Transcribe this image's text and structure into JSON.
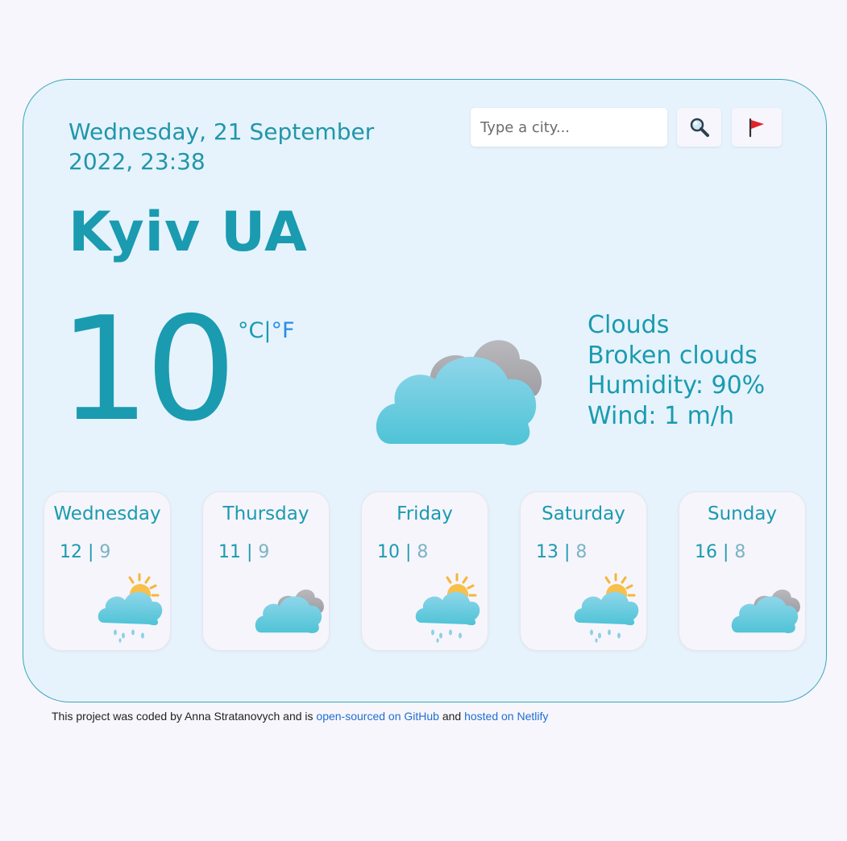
{
  "header": {
    "date_line1": "Wednesday, 21 September",
    "date_line2": "2022, 23:38"
  },
  "search": {
    "placeholder": "Type a city...",
    "search_icon": "magnifying-glass",
    "location_icon": "red-flag"
  },
  "current": {
    "city": "Kyiv UA",
    "temperature": "10",
    "unit_c": "°C",
    "unit_separator": "|",
    "unit_f": "°F",
    "icon": "broken-clouds",
    "description_main": "Clouds",
    "description_detail": "Broken clouds",
    "humidity": "Humidity: 90%",
    "wind": "Wind: 1 m/h"
  },
  "forecast": [
    {
      "day": "Wednesday",
      "max": "12",
      "min": "9",
      "icon": "sun-rain"
    },
    {
      "day": "Thursday",
      "max": "11",
      "min": "9",
      "icon": "broken-clouds"
    },
    {
      "day": "Friday",
      "max": "10",
      "min": "8",
      "icon": "sun-rain"
    },
    {
      "day": "Saturday",
      "max": "13",
      "min": "8",
      "icon": "sun-rain"
    },
    {
      "day": "Sunday",
      "max": "16",
      "min": "8",
      "icon": "broken-clouds"
    }
  ],
  "footer": {
    "text_prefix": "This project was coded by Anna Stratanovych and is ",
    "link_github": "open-sourced on GitHub",
    "text_middle": " and ",
    "link_netlify": "hosted on Netlify"
  },
  "colors": {
    "accent": "#1a9bb0",
    "card_bg": "#e6f3fc",
    "link": "#1f6fd1"
  }
}
